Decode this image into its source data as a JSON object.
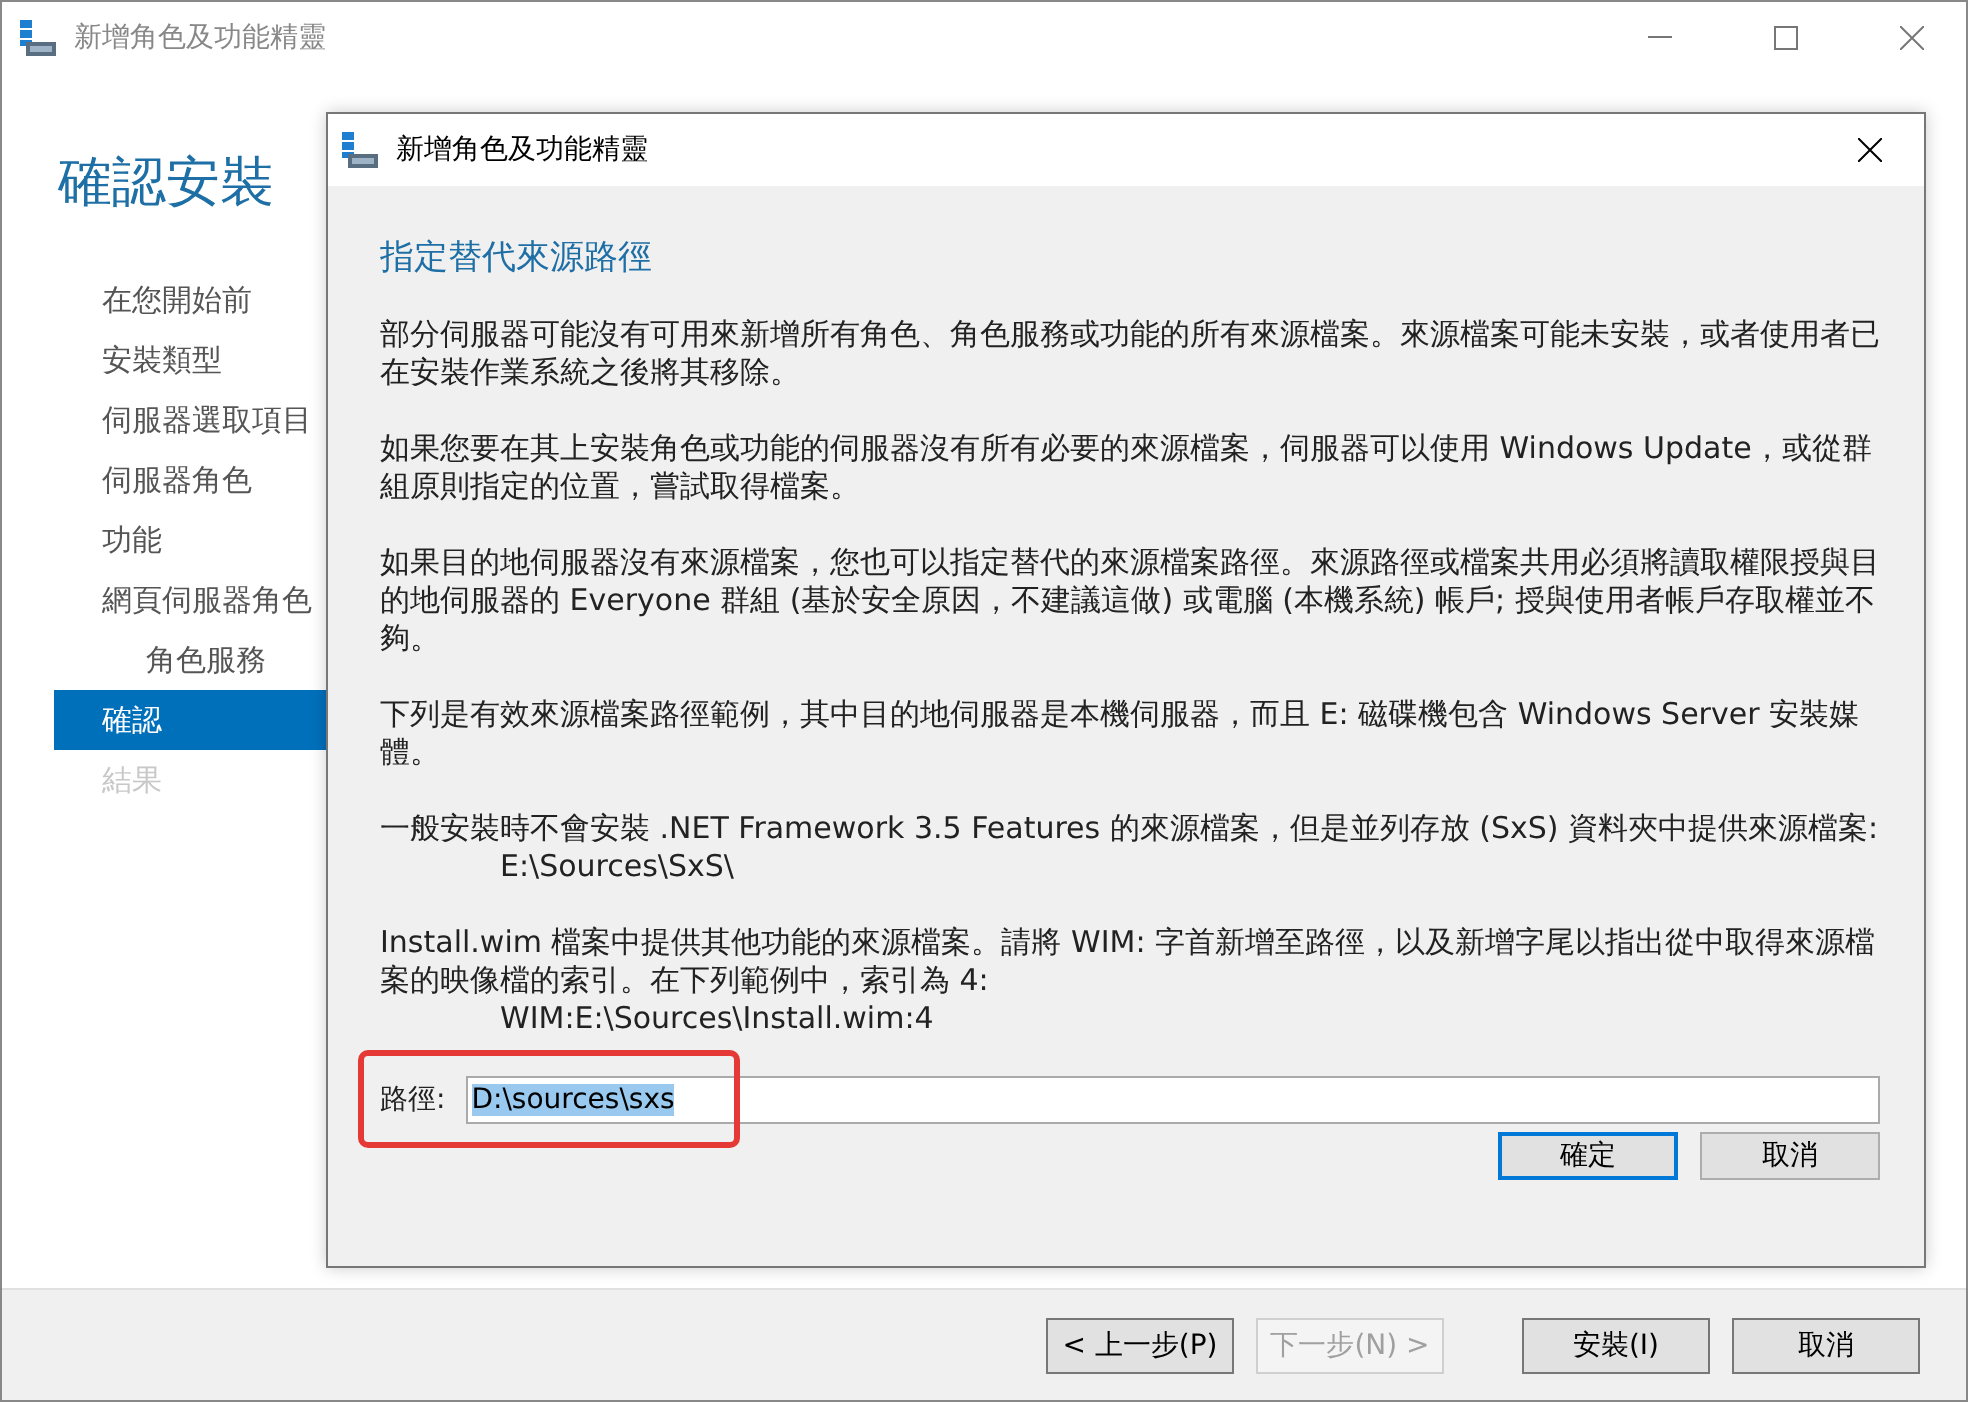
{
  "window": {
    "title": "新增角色及功能精靈"
  },
  "page_heading": "確認安裝",
  "steps": [
    {
      "label": "在您開始前",
      "selected": false,
      "disabled": false
    },
    {
      "label": "安裝類型",
      "selected": false,
      "disabled": false
    },
    {
      "label": "伺服器選取項目",
      "selected": false,
      "disabled": false
    },
    {
      "label": "伺服器角色",
      "selected": false,
      "disabled": false
    },
    {
      "label": "功能",
      "selected": false,
      "disabled": false
    },
    {
      "label": "網頁伺服器角色",
      "selected": false,
      "disabled": false,
      "children": [
        {
          "label": "角色服務",
          "selected": false,
          "disabled": false
        }
      ]
    },
    {
      "label": "確認",
      "selected": true,
      "disabled": false
    },
    {
      "label": "結果",
      "selected": false,
      "disabled": true
    }
  ],
  "nav_buttons": [
    {
      "label": "< 上一步(P)",
      "disabled": false
    },
    {
      "label": "下一步(N) >",
      "disabled": true
    },
    {
      "label": "安裝(I)",
      "disabled": false
    },
    {
      "label": "取消",
      "disabled": false
    }
  ],
  "dialog": {
    "title": "新增角色及功能精靈",
    "heading": "指定替代來源路徑",
    "paragraphs": [
      {
        "text": "部分伺服器可能沒有可用來新增所有角色、角色服務或功能的所有來源檔案。來源檔案可能未安裝，或者使用者已在安裝作業系統之後將其移除。"
      },
      {
        "text": "如果您要在其上安裝角色或功能的伺服器沒有所有必要的來源檔案，伺服器可以使用 Windows Update，或從群組原則指定的位置，嘗試取得檔案。"
      },
      {
        "text": "如果目的地伺服器沒有來源檔案，您也可以指定替代的來源檔案路徑。來源路徑或檔案共用必須將讀取權限授與目的地伺服器的 Everyone 群組 (基於安全原因，不建議這做) 或電腦 (本機系統) 帳戶; 授與使用者帳戶存取權並不夠。"
      },
      {
        "text": "下列是有效來源檔案路徑範例，其中目的地伺服器是本機伺服器，而且 E: 磁碟機包含 Windows Server 安裝媒體。"
      },
      {
        "text": "一般安裝時不會安裝 .NET Framework 3.5 Features 的來源檔案，但是並列存放 (SxS) 資料夾中提供來源檔案:",
        "example": "E:\\Sources\\SxS\\"
      },
      {
        "text": "Install.wim 檔案中提供其他功能的來源檔案。請將 WIM: 字首新增至路徑，以及新增字尾以指出從中取得來源檔案的映像檔的索引。在下列範例中，索引為 4:",
        "example": "WIM:E:\\Sources\\Install.wim:4"
      }
    ],
    "path": {
      "label": "路徑:",
      "value": "D:\\sources\\sxs",
      "text_selected": true,
      "highlighted": true
    },
    "buttons": [
      {
        "label": "確定",
        "default": true
      },
      {
        "label": "取消",
        "default": false
      }
    ]
  }
}
